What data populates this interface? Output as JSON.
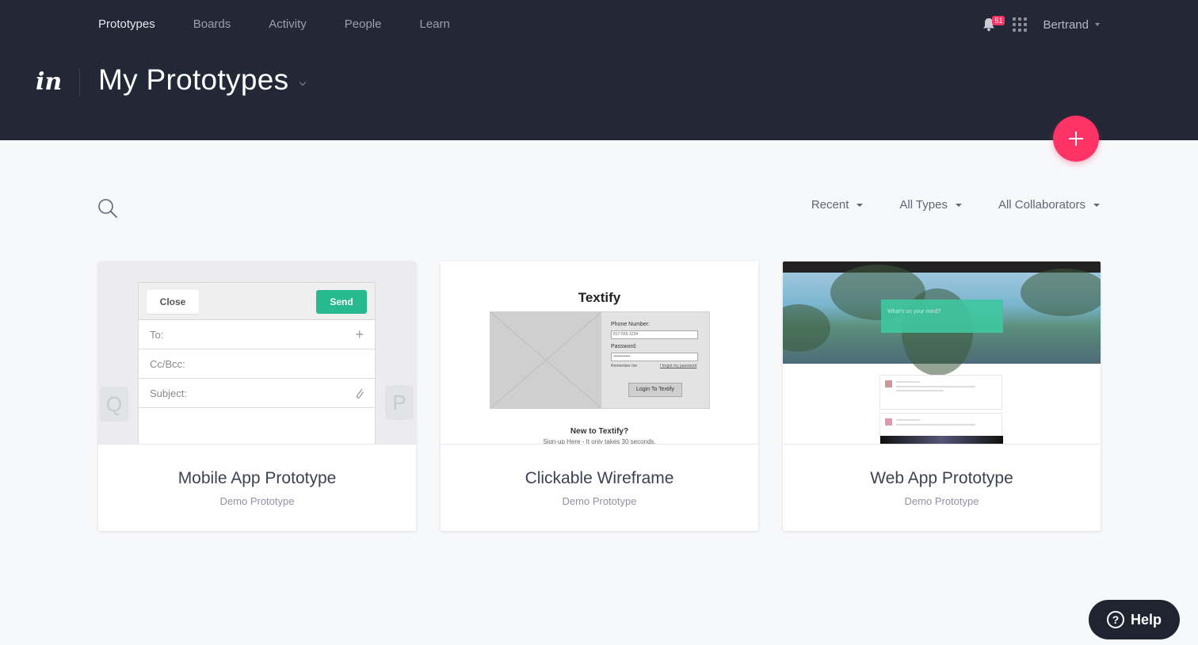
{
  "nav": {
    "items": [
      {
        "label": "Prototypes",
        "active": true
      },
      {
        "label": "Boards"
      },
      {
        "label": "Activity"
      },
      {
        "label": "People"
      },
      {
        "label": "Learn"
      }
    ]
  },
  "header": {
    "notification_count": "51",
    "user_name": "Bertrand",
    "logo_text": "in",
    "page_title": "My Prototypes"
  },
  "filters": {
    "sort": "Recent",
    "type": "All Types",
    "collaborators": "All Collaborators"
  },
  "cards": [
    {
      "title": "Mobile App Prototype",
      "subtitle": "Demo Prototype",
      "thumb": {
        "close": "Close",
        "send": "Send",
        "to": "To:",
        "ccbcc": "Cc/Bcc:",
        "subject": "Subject:",
        "key_left": "Q",
        "key_right": "P"
      }
    },
    {
      "title": "Clickable Wireframe",
      "subtitle": "Demo Prototype",
      "thumb": {
        "heading": "Textify",
        "phone_label": "Phone Number:",
        "phone_value": "817-555-1234",
        "password_label": "Password:",
        "password_value": "••••••••••••",
        "remember": "Remember me",
        "forgot": "I forgot my password",
        "login": "Login To Textify",
        "new_to": "New to Textify?",
        "signup": "Sign-up Here - It only takes 30 seconds."
      }
    },
    {
      "title": "Web App Prototype",
      "subtitle": "Demo Prototype",
      "thumb": {
        "post_placeholder": "What's on your mind?"
      }
    }
  ],
  "help": {
    "label": "Help"
  },
  "colors": {
    "header_bg": "#222836",
    "accent": "#ff3366",
    "send_green": "#27ba91"
  }
}
